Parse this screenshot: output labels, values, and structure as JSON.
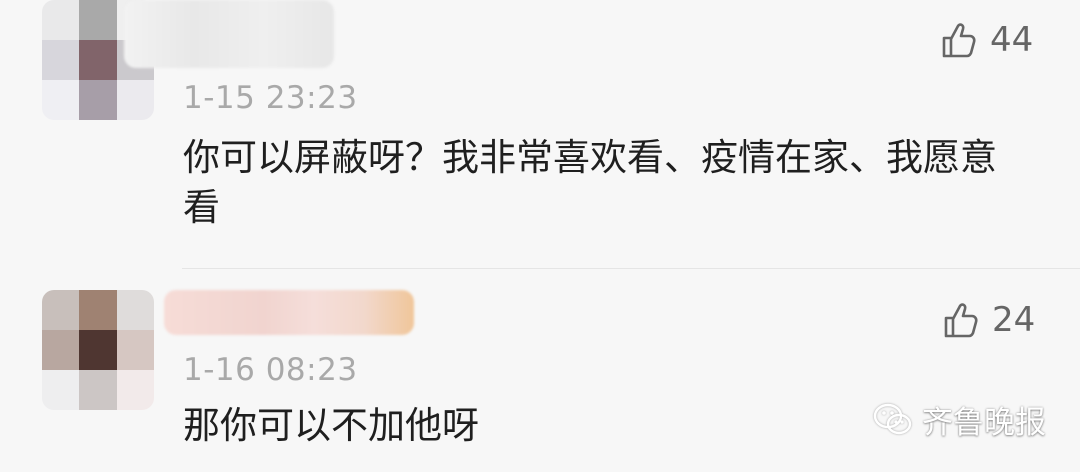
{
  "comments": [
    {
      "timestamp": "1-15 23:23",
      "text": "你可以屏蔽呀？我非常喜欢看、疫情在家、我愿意看",
      "likes": "44"
    },
    {
      "timestamp": "1-16 08:23",
      "text": "那你可以不加他呀",
      "likes": "24"
    }
  ],
  "watermark": {
    "name": "齐鲁晚报"
  },
  "icons": {
    "like": "thumbs-up-icon",
    "watermark": "wechat-official-account-icon"
  },
  "colors": {
    "background": "#f7f7f7",
    "text": "#1f1f1f",
    "timestamp": "#a9a9a9",
    "like_count": "#666666",
    "divider": "#e5e5e5"
  }
}
